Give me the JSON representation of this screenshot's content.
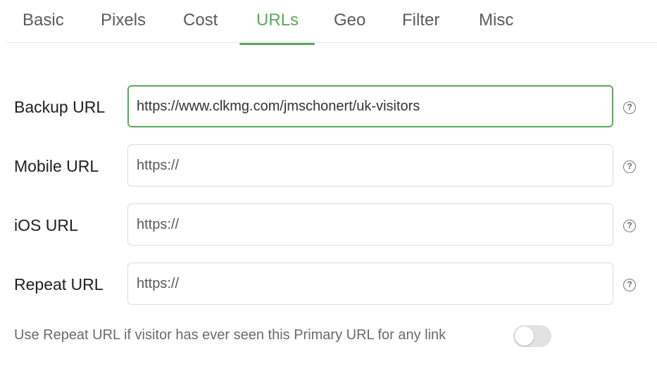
{
  "tabs": [
    {
      "label": "Basic"
    },
    {
      "label": "Pixels"
    },
    {
      "label": "Cost"
    },
    {
      "label": "URLs"
    },
    {
      "label": "Geo"
    },
    {
      "label": "Filter"
    },
    {
      "label": "Misc"
    }
  ],
  "active_tab": "URLs",
  "fields": {
    "backup": {
      "label": "Backup URL",
      "value": "https://www.clkmg.com/jmschonert/uk-visitors",
      "placeholder": "https://"
    },
    "mobile": {
      "label": "Mobile URL",
      "value": "",
      "placeholder": "https://"
    },
    "ios": {
      "label": "iOS URL",
      "value": "",
      "placeholder": "https://"
    },
    "repeat": {
      "label": "Repeat URL",
      "value": "",
      "placeholder": "https://"
    }
  },
  "help_glyph": "?",
  "repeat_toggle": {
    "text": "Use Repeat URL if visitor has ever seen this Primary URL for any link",
    "on": false
  },
  "colors": {
    "accent": "#5ea65e",
    "toggle_off": "#e2e2e2"
  },
  "icons": {
    "help": "question-circle-icon"
  }
}
